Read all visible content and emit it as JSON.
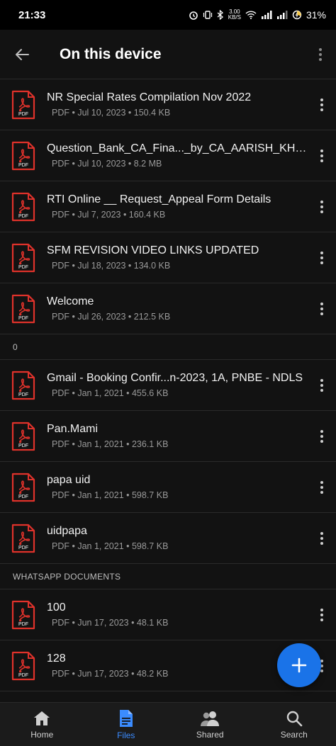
{
  "status_bar": {
    "time": "21:33",
    "net_speed_value": "3.00",
    "net_speed_unit": "KB/S",
    "battery": "31%"
  },
  "app_bar": {
    "title": "On this device"
  },
  "sections": [
    {
      "header": "",
      "files": [
        {
          "name": "NR Special Rates Compilation Nov 2022",
          "meta": "PDF  •  Jul 10, 2023  •  150.4 KB"
        },
        {
          "name": "Question_Bank_CA_Fina..._by_CA_AARISH_KHAN",
          "meta": "PDF  •  Jul 10, 2023  •  8.2 MB"
        },
        {
          "name": "RTI Online __ Request_Appeal Form Details",
          "meta": "PDF  •  Jul 7, 2023  •  160.4 KB"
        },
        {
          "name": "SFM REVISION VIDEO LINKS UPDATED",
          "meta": "PDF  •  Jul 18, 2023  •  134.0 KB"
        },
        {
          "name": "Welcome",
          "meta": "PDF  •  Jul 26, 2023  •  212.5 KB"
        }
      ]
    },
    {
      "header": "0",
      "files": [
        {
          "name": "Gmail - Booking Confir...n-2023, 1A, PNBE - NDLS",
          "meta": "PDF  •  Jan 1, 2021  •  455.6 KB"
        },
        {
          "name": "Pan.Mami",
          "meta": "PDF  •  Jan 1, 2021  •  236.1 KB"
        },
        {
          "name": "papa uid",
          "meta": "PDF  •  Jan 1, 2021  •  598.7 KB"
        },
        {
          "name": "uidpapa",
          "meta": "PDF  •  Jan 1, 2021  •  598.7 KB"
        }
      ]
    },
    {
      "header": "WHATSAPP DOCUMENTS",
      "files": [
        {
          "name": "100",
          "meta": "PDF  •  Jun 17, 2023  •  48.1 KB"
        },
        {
          "name": "128",
          "meta": "PDF  •  Jun 17, 2023  •  48.2 KB"
        }
      ]
    }
  ],
  "pdf_badge": "PDF",
  "bottom_nav": {
    "items": [
      {
        "label": "Home",
        "icon": "home-icon",
        "active": false
      },
      {
        "label": "Files",
        "icon": "files-icon",
        "active": true
      },
      {
        "label": "Shared",
        "icon": "shared-icon",
        "active": false
      },
      {
        "label": "Search",
        "icon": "search-icon",
        "active": false
      }
    ]
  },
  "colors": {
    "accent": "#1a73e8",
    "pdf_red": "#e0322b",
    "background": "#121212"
  }
}
